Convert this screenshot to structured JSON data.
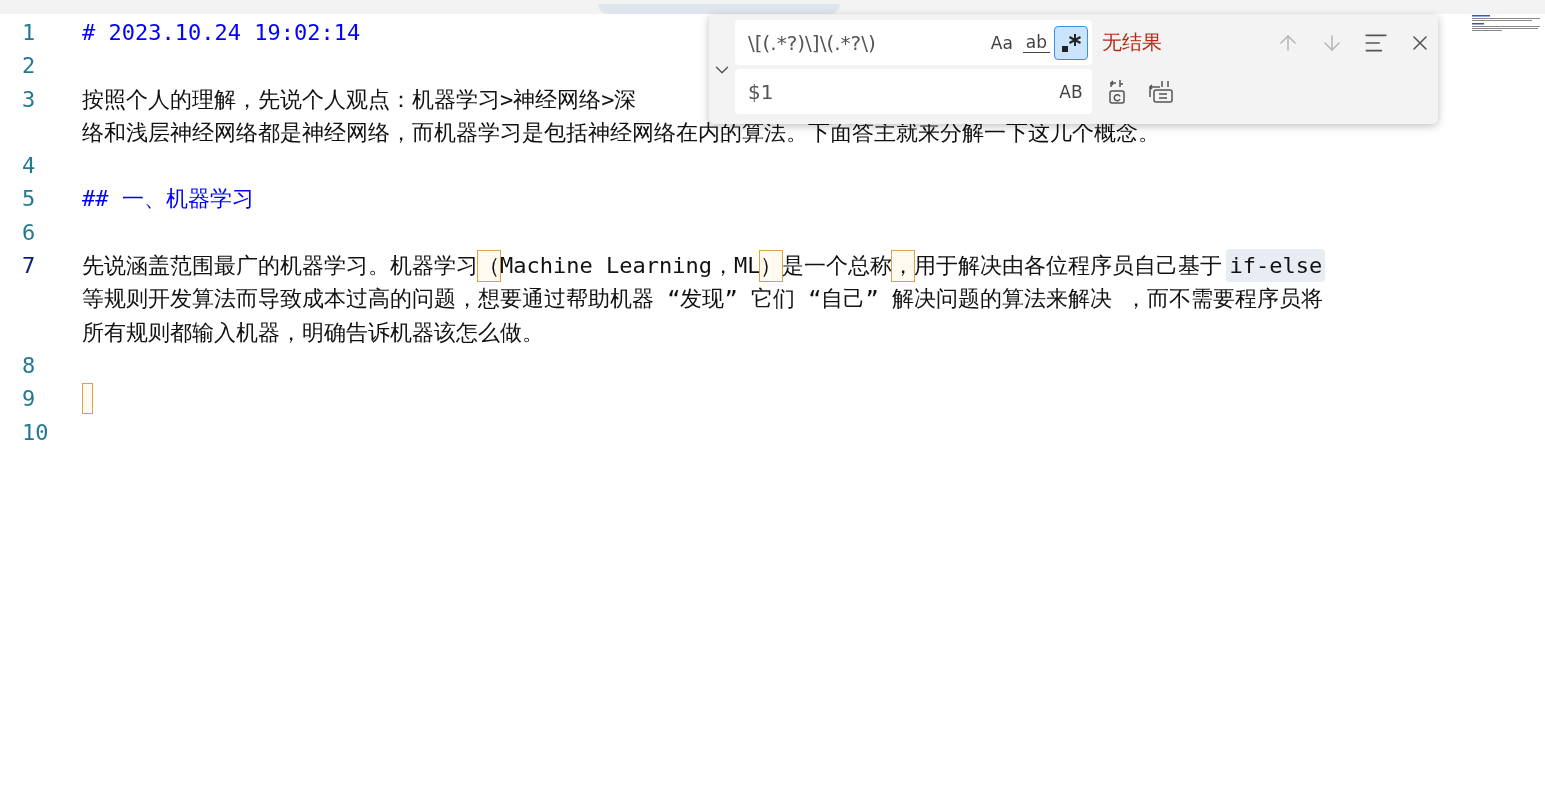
{
  "tab_bar": {
    "selected_tab": true
  },
  "lines": [
    {
      "number": "1",
      "current": false,
      "rows": [
        [
          {
            "kind": "heading",
            "text": "# 2023.10.24 19:02:14"
          }
        ]
      ]
    },
    {
      "number": "2",
      "current": false
    },
    {
      "number": "3",
      "current": false,
      "rows": [
        [
          {
            "kind": "text",
            "text": "按照个人的理解，先说个人观点：机器学习>神经网络>深"
          }
        ],
        [
          {
            "kind": "text",
            "text": "络和浅层神经网络都是神经网络，而机器学习是包括神经网络在内的算法。下面答主就来分解一下这几个概念。"
          }
        ]
      ]
    },
    {
      "number": "4",
      "current": false
    },
    {
      "number": "5",
      "current": false,
      "rows": [
        [
          {
            "kind": "heading",
            "text": "## 一、机器学习"
          }
        ]
      ]
    },
    {
      "number": "6",
      "current": false
    },
    {
      "number": "7",
      "current": true,
      "rows": [
        [
          {
            "kind": "text",
            "text": "先说涵盖范围最广的机器学习。机器学习"
          },
          {
            "kind": "boxed",
            "text": "（"
          },
          {
            "kind": "text",
            "text": "Machine Learning，ML"
          },
          {
            "kind": "boxed",
            "text": "）"
          },
          {
            "kind": "text",
            "text": "是一个总称"
          },
          {
            "kind": "boxed",
            "text": "，"
          },
          {
            "kind": "text",
            "text": "用于解决由各位程序员自己基于 "
          },
          {
            "kind": "code",
            "text": "if-else"
          }
        ],
        [
          {
            "kind": "text",
            "text": "等规则开发算法而导致成本过高的问题，想要通过帮助机器 “发现” 它们 “自己” 解决问题的算法来解决 ，而不需要程序员将"
          }
        ],
        [
          {
            "kind": "text",
            "text": "所有规则都输入机器，明确告诉机器该怎么做。"
          }
        ]
      ]
    },
    {
      "number": "8",
      "current": false
    },
    {
      "number": "9",
      "current": false,
      "cursor": true
    },
    {
      "number": "10",
      "current": false
    }
  ],
  "find_widget": {
    "expanded": true,
    "find": {
      "value": "\\[(.*?)\\]\\(.*?\\)",
      "options": [
        {
          "kind": "case",
          "label": "Aa",
          "selected": false
        },
        {
          "kind": "word",
          "label": "ab",
          "selected": false
        },
        {
          "kind": "regex",
          "selected": true
        }
      ]
    },
    "result": "无结果",
    "prev_disabled": true,
    "next_disabled": true,
    "replace": {
      "value": "$1",
      "preserve_case": {
        "label": "AB",
        "selected": false
      }
    }
  }
}
